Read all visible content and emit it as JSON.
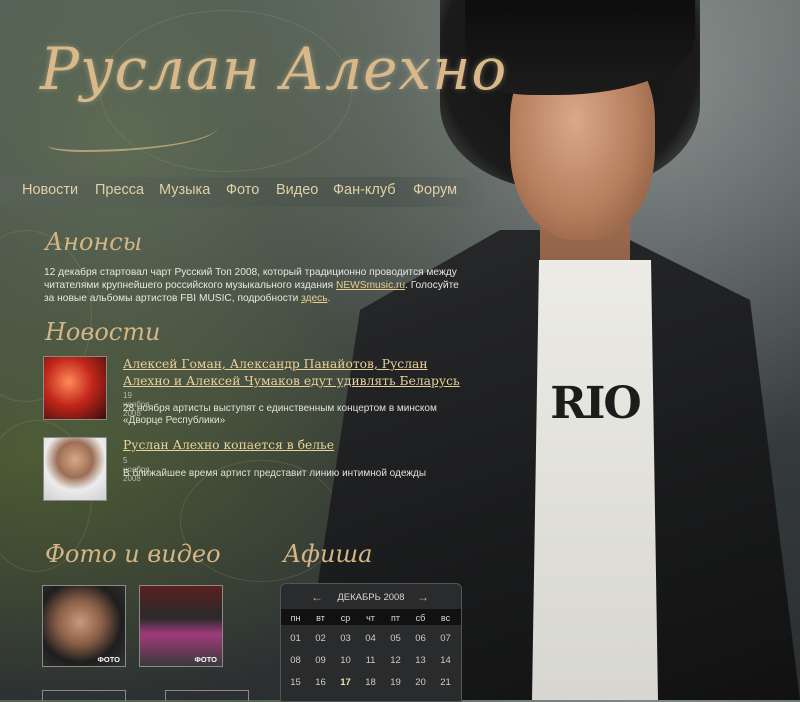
{
  "site": {
    "logo_text": "Руслан Алехно"
  },
  "nav": {
    "items": [
      "Новости",
      "Пресса",
      "Музыка",
      "Фото",
      "Видео",
      "Фан-клуб",
      "Форум"
    ]
  },
  "announcements": {
    "title": "Анонсы",
    "text_part1": "12 декабря стартовал чарт Русский Топ 2008, который традиционно проводится между читателями крупнейшего российского музыкального издания ",
    "link1": "NEWSmusic.ru",
    "text_part2": ". Голосуйте за новые альбомы артистов FBI MUSIC, подробности ",
    "link2": "здесь",
    "text_part3": "."
  },
  "news": {
    "title": "Новости",
    "items": [
      {
        "title": "Алексей Гоман, Александр Панайотов, Руслан Алехно и Алексей Чумаков едут удивлять Беларусь",
        "date": "19 ноября 2008",
        "text": "28 ноября артисты выступят с единственным концертом в минском «Дворце Республики»"
      },
      {
        "title": "Руслан Алехно копается в белье",
        "date": "5 ноября 2008",
        "text": "В ближайшее время артист представит линию интимной одежды"
      }
    ]
  },
  "media": {
    "title": "Фото и видео",
    "photo_tag": "ФОТО"
  },
  "poster": {
    "title": "Афиша"
  },
  "calendar": {
    "month_label": "ДЕКАБРЬ 2008",
    "prev_arrow": "←",
    "next_arrow": "→",
    "day_names": [
      "пн",
      "вт",
      "ср",
      "чт",
      "пт",
      "сб",
      "вс"
    ],
    "weeks": [
      [
        "01",
        "02",
        "03",
        "04",
        "05",
        "06",
        "07"
      ],
      [
        "08",
        "09",
        "10",
        "11",
        "12",
        "13",
        "14"
      ],
      [
        "15",
        "16",
        "17",
        "18",
        "19",
        "20",
        "21"
      ]
    ],
    "highlight_day": "17"
  },
  "artwork": {
    "shirt_print": "RIO"
  }
}
